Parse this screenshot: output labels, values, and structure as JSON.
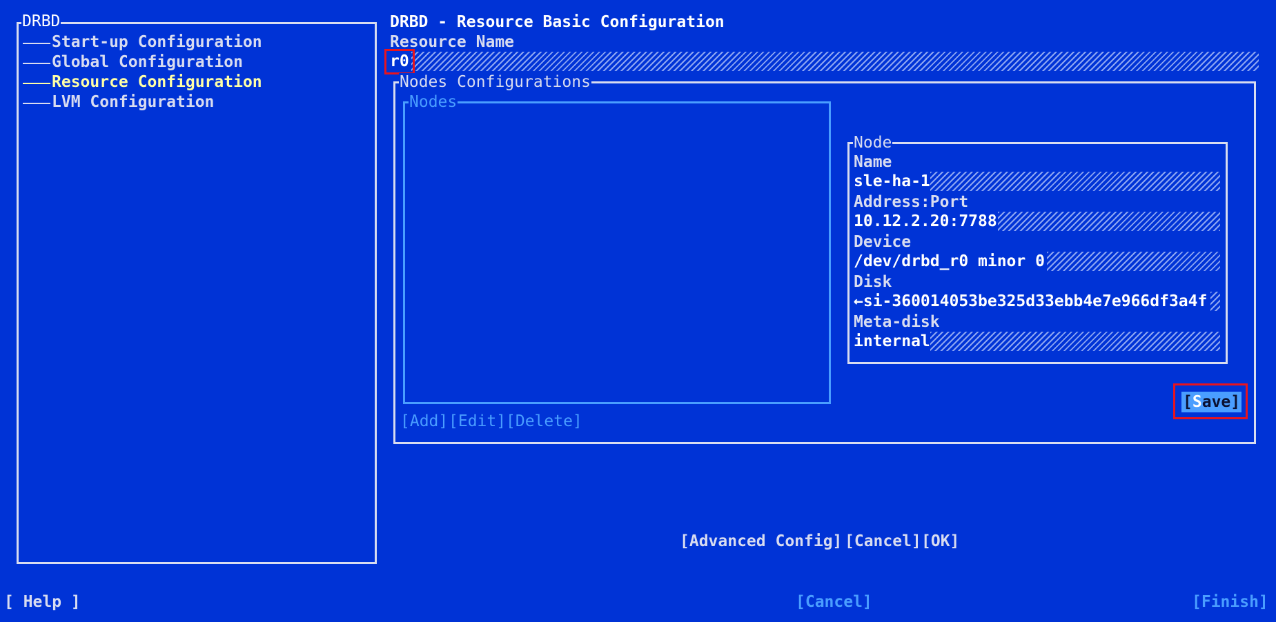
{
  "sidebar": {
    "title": "DRBD",
    "items": [
      {
        "label": "Start-up Configuration",
        "selected": false
      },
      {
        "label": "Global Configuration",
        "selected": false
      },
      {
        "label": "Resource Configuration",
        "selected": true
      },
      {
        "label": "LVM Configuration",
        "selected": false
      }
    ]
  },
  "main": {
    "title": "DRBD - Resource Basic Configuration",
    "resource_name_label": "Resource Name",
    "resource_name_value": "r0",
    "nodes_config_label": "Nodes Configurations",
    "nodes_list_label": "Nodes",
    "node_panel": {
      "label": "Node",
      "name_label": "Name",
      "name_value": "sle-ha-1",
      "address_label": "Address:Port",
      "address_value": "10.12.2.20:7788",
      "device_label": "Device",
      "device_value": "/dev/drbd_r0 minor 0",
      "disk_label": "Disk",
      "disk_value": "←si-360014053be325d33ebb4e7e966df3a4f",
      "metadisk_label": "Meta-disk",
      "metadisk_value": "internal"
    },
    "list_buttons": {
      "add": "[Add]",
      "edit": "[Edit]",
      "delete": "[Delete]"
    },
    "save_button": {
      "open": "[",
      "hotkey": "S",
      "rest": "ave",
      "close": "]"
    },
    "dialog_buttons": {
      "advanced": "[Advanced Config]",
      "cancel": "[Cancel]",
      "ok": "[OK]"
    }
  },
  "footer": {
    "help": "[ Help ]",
    "cancel": "[Cancel]",
    "finish": "[Finish]"
  },
  "colors": {
    "background": "#0033d6",
    "text": "#d8dcf0",
    "highlight": "#ffffa6",
    "dim": "#4a9eff",
    "focus": "#e8141e"
  }
}
